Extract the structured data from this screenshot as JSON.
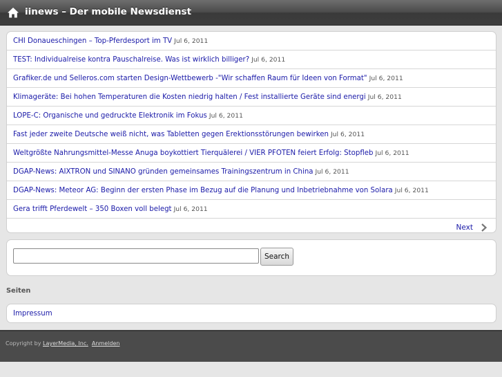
{
  "header": {
    "title": "iinews – Der mobile Newsdienst",
    "icon": "home-icon"
  },
  "news": [
    {
      "title": "CHI Donaueschingen – Top-Pferdesport im TV",
      "date": "Jul 6, 2011"
    },
    {
      "title": "TEST: Individualreise kontra Pauschalreise. Was ist wirklich billiger?",
      "date": "Jul 6, 2011"
    },
    {
      "title": "Grafiker.de und Selleros.com starten Design-Wettbewerb -\"Wir schaffen Raum für Ideen von Format\"",
      "date": "Jul 6, 2011"
    },
    {
      "title": "Klimageräte: Bei hohen Temperaturen die Kosten niedrig halten / Fest installierte Geräte sind energi",
      "date": "Jul 6, 2011"
    },
    {
      "title": "LOPE-C: Organische und gedruckte Elektronik im Fokus",
      "date": "Jul 6, 2011"
    },
    {
      "title": "Fast jeder zweite Deutsche weiß nicht, was Tabletten gegen Erektionsstörungen bewirken",
      "date": "Jul 6, 2011"
    },
    {
      "title": "Weltgrößte Nahrungsmittel-Messe Anuga boykottiert Tierquälerei / VIER PFOTEN feiert Erfolg: Stopfleb",
      "date": "Jul 6, 2011"
    },
    {
      "title": "DGAP-News: AIXTRON und SINANO gründen gemeinsames Trainingszentrum in China",
      "date": "Jul 6, 2011"
    },
    {
      "title": "DGAP-News: Meteor AG: Beginn der ersten Phase im Bezug auf die Planung und Inbetriebnahme von Solara",
      "date": "Jul 6, 2011"
    },
    {
      "title": "Gera trifft Pferdewelt – 350 Boxen voll belegt",
      "date": "Jul 6, 2011"
    }
  ],
  "pagination": {
    "next_label": "Next",
    "icon": "chevron-right-icon"
  },
  "search": {
    "value": "",
    "placeholder": "",
    "button_label": "Search"
  },
  "pages_section": {
    "heading": "Seiten",
    "items": [
      {
        "label": "Impressum"
      }
    ]
  },
  "footer": {
    "copyright_prefix": "Copyright by",
    "company": "LayerMedia, Inc.",
    "login": "Anmelden"
  },
  "colors": {
    "link": "#1a1aa8",
    "topbar": "#4a4a4a",
    "background": "#e6e6e6",
    "footer": "#4b4b4b"
  }
}
